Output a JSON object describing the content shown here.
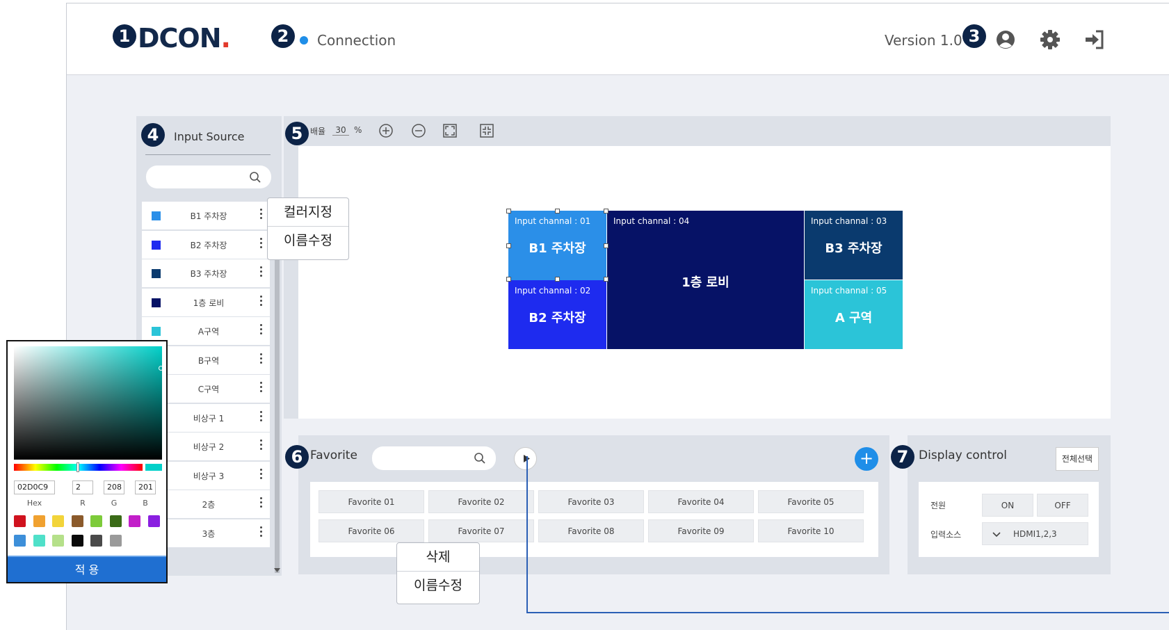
{
  "header": {
    "logo_main": "DCON",
    "logo_dot": ".",
    "connection_label": "Connection",
    "version": "Version 1.0",
    "icons": [
      "user-circle-icon",
      "gear-icon",
      "logout-icon"
    ]
  },
  "badges": [
    "1",
    "2",
    "3",
    "4",
    "5",
    "6",
    "7"
  ],
  "input_source": {
    "title": "Input Source",
    "search_placeholder": "",
    "items": [
      {
        "label": "B1 주차장",
        "color": "#2B8FE8"
      },
      {
        "label": "B2 주차장",
        "color": "#1E2BEF"
      },
      {
        "label": "B3 주차장",
        "color": "#0A3A6E"
      },
      {
        "label": "1층 로비",
        "color": "#061266"
      },
      {
        "label": "A구역",
        "color": "#2BC4D8"
      },
      {
        "label": "B구역",
        "color": ""
      },
      {
        "label": "C구역",
        "color": ""
      },
      {
        "label": "비상구 1",
        "color": ""
      },
      {
        "label": "비상구 2",
        "color": ""
      },
      {
        "label": "비상구 3",
        "color": ""
      },
      {
        "label": "2층",
        "color": ""
      },
      {
        "label": "3층",
        "color": ""
      }
    ],
    "context_menu": [
      "컬러지정",
      "이름수정"
    ]
  },
  "toolbar": {
    "zoom_label": "배율",
    "zoom_value": "30",
    "zoom_unit": "%"
  },
  "canvas": {
    "tiles": [
      {
        "channel": "Input channal : 01",
        "name": "B1 주차장",
        "color": "#2B8FE8"
      },
      {
        "channel": "Input channal : 02",
        "name": "B2 주차장",
        "color": "#1E2BEF"
      },
      {
        "channel": "Input channal : 04",
        "name": "1층 로비",
        "color": "#061266"
      },
      {
        "channel": "Input channal : 03",
        "name": "B3 주차장",
        "color": "#0A3A6E"
      },
      {
        "channel": "Input channal : 05",
        "name": "A 구역",
        "color": "#2BC4D8"
      }
    ]
  },
  "favorite": {
    "title": "Favorite",
    "search_placeholder": "",
    "buttons": [
      "Favorite 01",
      "Favorite 02",
      "Favorite 03",
      "Favorite 04",
      "Favorite 05",
      "Favorite 06",
      "Favorite 07",
      "Favorite 08",
      "Favorite 09",
      "Favorite 10"
    ],
    "context_menu": [
      "삭제",
      "이름수정"
    ]
  },
  "display_control": {
    "title": "Display control",
    "select_all": "전체선택",
    "power_label": "전원",
    "power_on": "ON",
    "power_off": "OFF",
    "input_label": "입력소스",
    "input_value": "HDMI1,2,3"
  },
  "color_picker": {
    "hex": "02D0C9",
    "r": "2",
    "g": "208",
    "b": "201",
    "hex_label": "Hex",
    "r_label": "R",
    "g_label": "G",
    "b_label": "B",
    "apply_label": "적 용",
    "current_color": "#02D0C9",
    "presets": [
      "#D0121E",
      "#F0A130",
      "#F2D43A",
      "#8B5A2B",
      "#7DCB3A",
      "#3A6B17",
      "#C21FC9",
      "#8A1FE0",
      "#3D8FD9",
      "#4FE0C9",
      "#B5E08A",
      "#0A0A0A",
      "#4A4A4A",
      "#9A9A9A"
    ]
  }
}
